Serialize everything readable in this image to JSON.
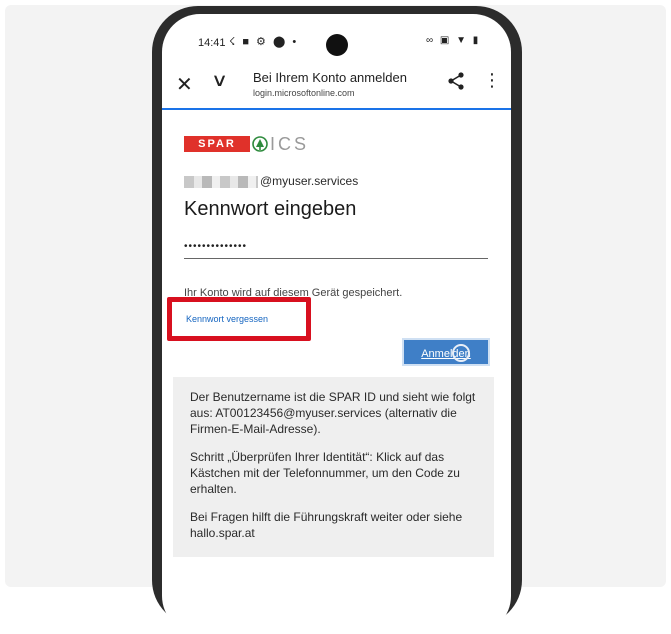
{
  "status_bar": {
    "time": "14:41",
    "left_icons": "☇ ■ ⚙ ⬤ •",
    "right_icons": "∞ ▣ ▼ ▮"
  },
  "browser": {
    "title": "Bei Ihrem Konto anmelden",
    "url": "login.microsoftonline.com",
    "close_icon": "✕",
    "chevron_icon": "∨",
    "more_icon": "⋮"
  },
  "login": {
    "logo_spar": "SPAR",
    "logo_ics": "ICS",
    "account_suffix": "@myuser.services",
    "heading": "Kennwort eingeben",
    "password_mask": "••••••••••••••",
    "saved_note": "Ihr Konto wird auf diesem Gerät gespeichert.",
    "forgot_link": "Kennwort vergessen",
    "signin_button": "Anmelden"
  },
  "info": {
    "p1": "Der Benutzername ist die SPAR ID und sieht wie folgt aus: AT00123456@myuser.services (alternativ die Firmen-E-Mail-Adresse).",
    "p2": "Schritt „Überprüfen Ihrer Identität“: Klick auf das Kästchen mit der Telefonnummer, um den Code zu erhalten.",
    "p3": "Bei Fragen hilft die Führungskraft weiter oder siehe hallo.spar.at"
  },
  "colors": {
    "highlight": "#d8101f",
    "button": "#3f7fc7",
    "link": "#1565c0",
    "spar_red": "#e0312a"
  }
}
